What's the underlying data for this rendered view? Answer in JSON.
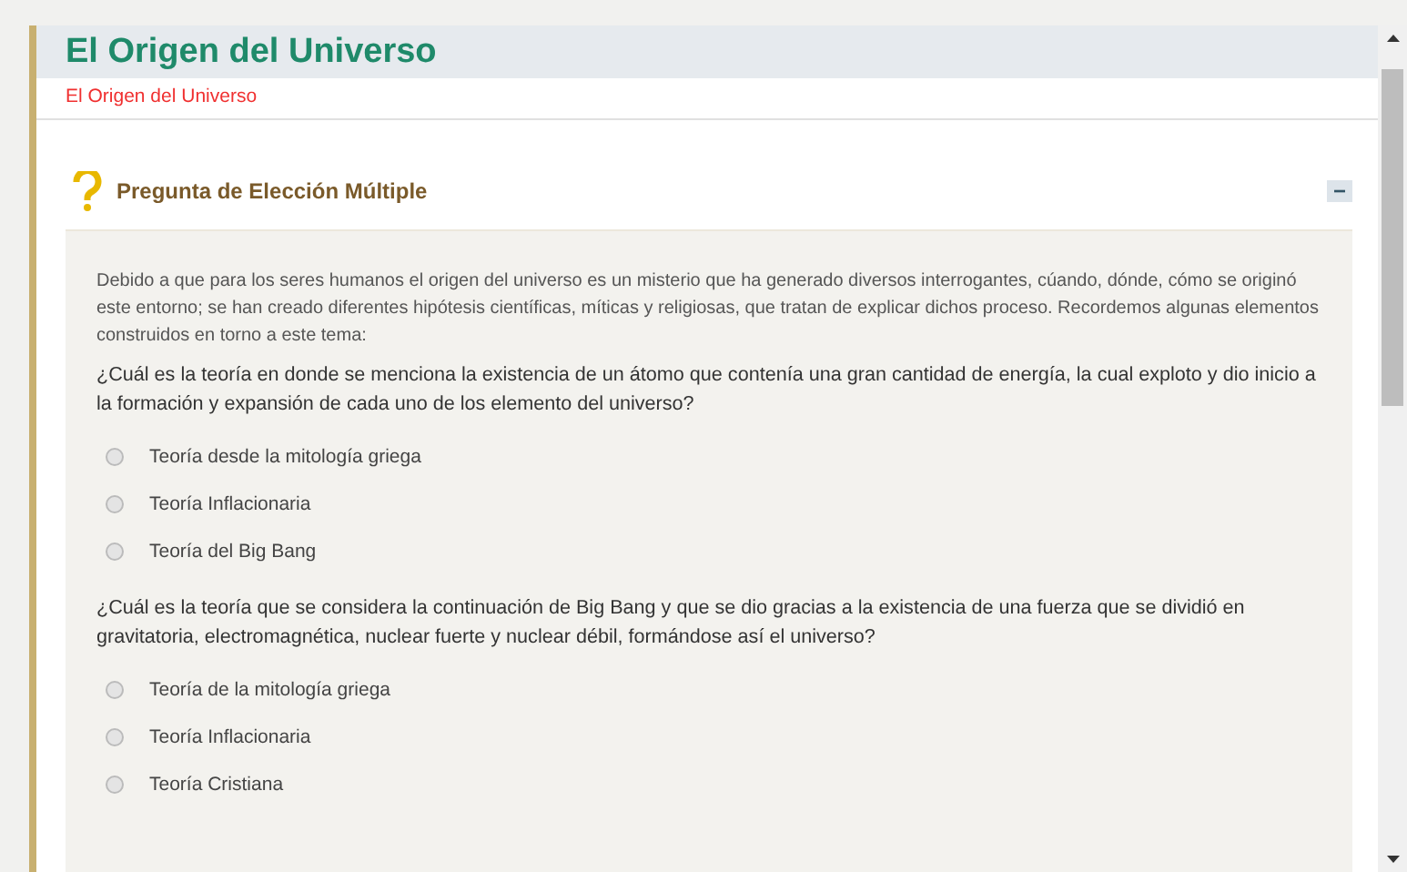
{
  "header": {
    "title": "El Origen del Universo",
    "breadcrumb": "El Origen del Universo"
  },
  "section": {
    "title": "Pregunta de Elección Múltiple",
    "collapse_symbol": "−"
  },
  "intro": "Debido a que para los seres humanos el origen del universo es un misterio que ha generado diversos interrogantes, cúando, dónde, cómo se originó este entorno; se han creado diferentes hipótesis científicas, míticas y religiosas, que tratan de explicar dichos proceso. Recordemos algunas elementos construidos en torno a este tema:",
  "questions": [
    {
      "text": "¿Cuál es la teoría en donde se menciona la existencia de un átomo que contenía una gran cantidad de energía, la cual exploto y dio inicio a la formación y expansión de cada uno de los elemento del universo?",
      "options": [
        {
          "label": "Teoría desde la mitología griega",
          "selected": false
        },
        {
          "label": "Teoría Inflacionaria",
          "selected": false
        },
        {
          "label": "Teoría del Big Bang",
          "selected": false
        }
      ]
    },
    {
      "text": "¿Cuál es la teoría que se considera la continuación de Big Bang y que se dio gracias a la existencia de una fuerza que se dividió en gravitatoria, electromagnética, nuclear fuerte y nuclear débil, formándose así el universo?",
      "options": [
        {
          "label": "Teoría de la mitología griega",
          "selected": false
        },
        {
          "label": "Teoría Inflacionaria",
          "selected": false
        },
        {
          "label": "Teoría Cristiana",
          "selected": false
        }
      ]
    }
  ]
}
